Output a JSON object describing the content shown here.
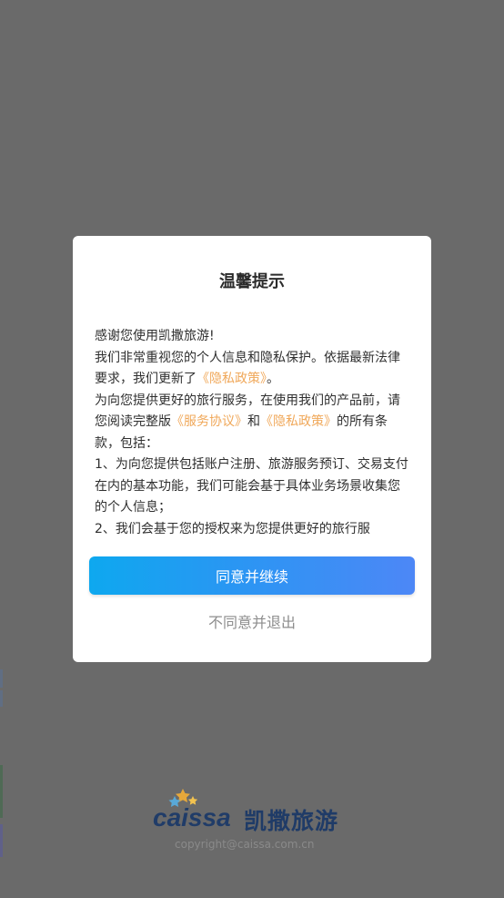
{
  "modal": {
    "title": "温馨提示",
    "body": {
      "line1": "感谢您使用凯撒旅游!",
      "line2_prefix": "我们非常重视您的个人信息和隐私保护。依据最新法律要求，我们更新了",
      "line2_link": "《隐私政策》",
      "line2_suffix": "。",
      "line3_prefix": "为向您提供更好的旅行服务，在使用我们的产品前，请您阅读完整版",
      "line3_link1": "《服务协议》",
      "line3_mid": "和",
      "line3_link2": "《隐私政策》",
      "line3_suffix": "的所有条款，包括：",
      "line4": "1、为向您提供包括账户注册、旅游服务预订、交易支付在内的基本功能，我们可能会基于具体业务场景收集您的个人信息；",
      "line5": "2、我们会基于您的授权来为您提供更好的旅行服"
    },
    "agree_label": "同意并继续",
    "disagree_label": "不同意并退出"
  },
  "brand": {
    "logo_text_en": "caissa",
    "logo_text_cn": "凯撒旅游",
    "copyright": "copyright@caissa.com.cn"
  },
  "colors": {
    "overlay": "#6a6a6a",
    "link": "#f0a85a",
    "button_start": "#0ea8ef",
    "button_end": "#4d87f6",
    "brand_blue": "#1f3b67"
  }
}
